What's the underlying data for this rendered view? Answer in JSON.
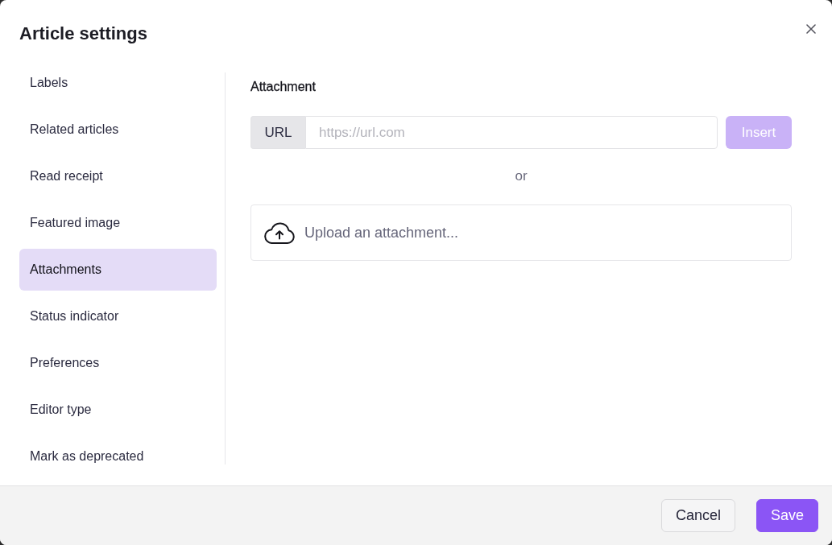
{
  "dialog": {
    "title": "Article settings"
  },
  "sidebar": {
    "items": [
      {
        "label": "Labels",
        "selected": false
      },
      {
        "label": "Related articles",
        "selected": false
      },
      {
        "label": "Read receipt",
        "selected": false
      },
      {
        "label": "Featured image",
        "selected": false
      },
      {
        "label": "Attachments",
        "selected": true
      },
      {
        "label": "Status indicator",
        "selected": false
      },
      {
        "label": "Preferences",
        "selected": false
      },
      {
        "label": "Editor type",
        "selected": false
      },
      {
        "label": "Mark as deprecated",
        "selected": false
      }
    ]
  },
  "content": {
    "heading": "Attachment",
    "url_input": {
      "addon": "URL",
      "placeholder": "https://url.com"
    },
    "insert_button": {
      "label": "Insert",
      "disabled": true
    },
    "separator": "or",
    "upload": {
      "label": "Upload an attachment..."
    }
  },
  "footer": {
    "buttons": [
      {
        "label": "Cancel",
        "kind": "secondary"
      },
      {
        "label": "Save",
        "kind": "primary"
      }
    ]
  }
}
